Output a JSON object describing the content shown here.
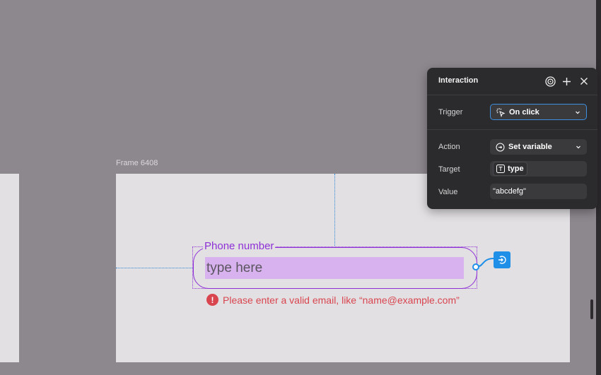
{
  "canvas": {
    "frame_label": "Frame 6408"
  },
  "field": {
    "label": "Phone number",
    "placeholder": "type here",
    "error": "Please enter a valid email, like “name@example.com”",
    "error_symbol": "!"
  },
  "panel": {
    "title": "Interaction",
    "header_icons": [
      "target-icon",
      "plus-icon",
      "close-icon"
    ],
    "trigger": {
      "label": "Trigger",
      "value": "On click",
      "icon": "cursor-click-icon"
    },
    "action": {
      "label": "Action",
      "value": "Set variable",
      "icon": "variable-icon"
    },
    "target": {
      "label": "Target",
      "value": "type",
      "icon": "text-type-icon"
    },
    "value": {
      "label": "Value",
      "value": "\"abcdefg\""
    }
  },
  "colors": {
    "canvas_bg": "#8d878e",
    "frame_bg": "#e2e0e3",
    "accent_purple": "#8e30d6",
    "input_fill": "#d8b2ee",
    "error_red": "#d9454f",
    "connector_blue": "#1f8fe8",
    "panel_bg": "#2b2b2d"
  }
}
